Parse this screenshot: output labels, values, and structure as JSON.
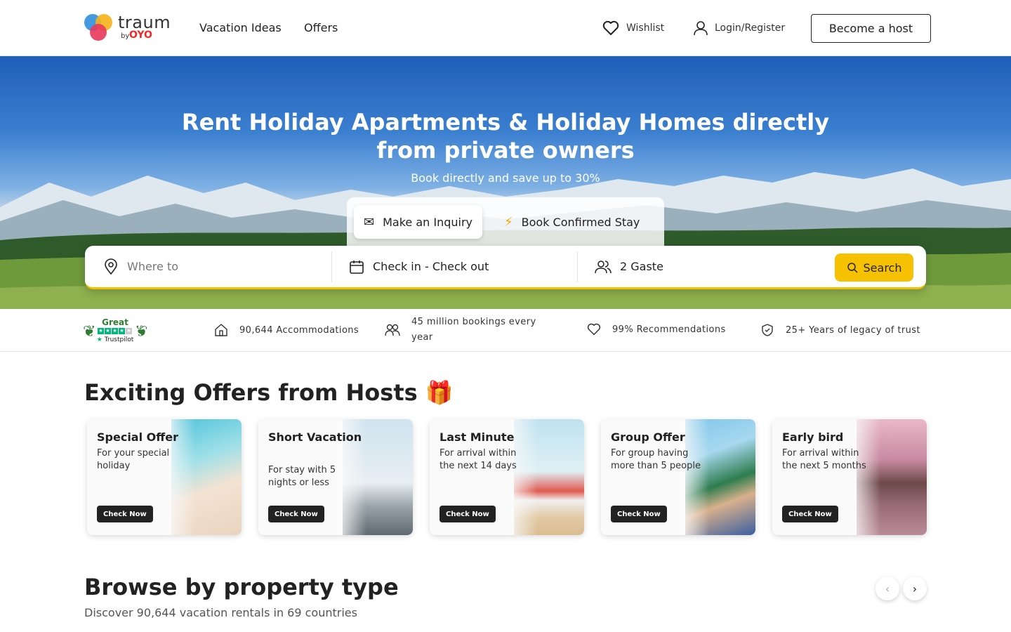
{
  "header": {
    "logo_word": "traum",
    "logo_by": "by",
    "logo_brand": "OYO",
    "nav": [
      "Vacation Ideas",
      "Offers"
    ],
    "wishlist": "Wishlist",
    "login": "Login/Register",
    "become_host": "Become a host"
  },
  "hero": {
    "title": "Rent Holiday Apartments & Holiday Homes directly from private owners",
    "subtitle": "Book directly and save up to 30%",
    "tabs": [
      {
        "label": "Make an Inquiry",
        "icon": "envelope-icon",
        "active": true
      },
      {
        "label": "Book Confirmed Stay",
        "icon": "lightning-icon",
        "active": false
      }
    ],
    "search": {
      "where_placeholder": "Where to",
      "dates": "Check in - Check out",
      "guests": "2 Gaste",
      "button": "Search"
    }
  },
  "trust": {
    "rating_word": "Great",
    "rating_source": "Trustpilot",
    "items": [
      {
        "icon": "house-icon",
        "text": "90,644 Accommodations"
      },
      {
        "icon": "people-icon",
        "text": "45 million bookings every year"
      },
      {
        "icon": "heart-icon",
        "text": "99% Recommendations"
      },
      {
        "icon": "shield-icon",
        "text": "25+ Years of legacy of trust"
      }
    ]
  },
  "offers": {
    "title": "Exciting Offers from Hosts 🎁",
    "cards": [
      {
        "title": "Special Offer",
        "desc": "For your special holiday",
        "button": "Check Now"
      },
      {
        "title": "Short Vacation",
        "desc": "For stay with 5 nights or less",
        "button": "Check Now"
      },
      {
        "title": "Last Minute",
        "desc": "For arrival within the next 14 days",
        "button": "Check Now"
      },
      {
        "title": "Group Offer",
        "desc": "For group having more than 5 people",
        "button": "Check Now"
      },
      {
        "title": "Early bird",
        "desc": "For arrival within the next 5 months",
        "button": "Check Now"
      }
    ]
  },
  "browse": {
    "title": "Browse by property type",
    "subtitle": "Discover 90,644 vacation rentals in 69 countries",
    "prev": "‹",
    "next": "›"
  },
  "colors": {
    "accent_yellow": "#f6c100",
    "dark_button": "#222222",
    "trustpilot_green": "#00b67a",
    "brand_red": "#ee2a24"
  }
}
